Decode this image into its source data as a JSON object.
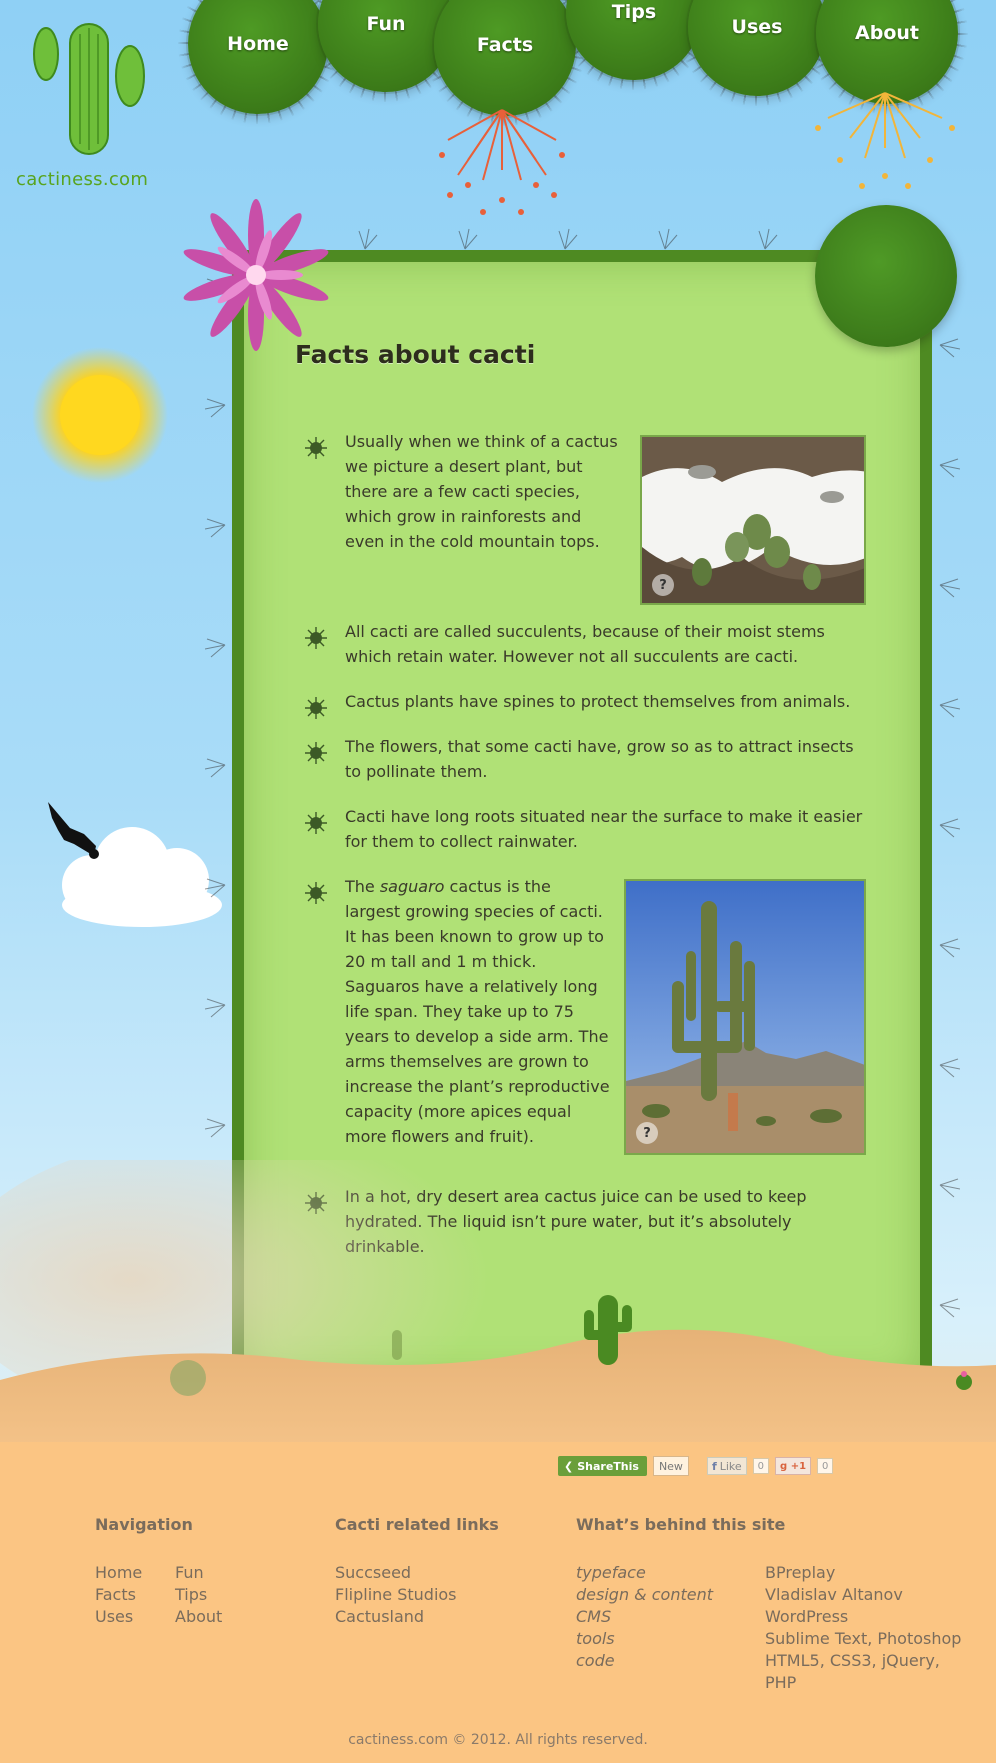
{
  "site": {
    "logo_text": "cactiness.com"
  },
  "nav": {
    "items": [
      {
        "label": "Home"
      },
      {
        "label": "Fun"
      },
      {
        "label": "Facts"
      },
      {
        "label": "Tips"
      },
      {
        "label": "Uses"
      },
      {
        "label": "About"
      }
    ]
  },
  "main": {
    "title": "Facts about cacti",
    "facts": [
      {
        "text": "Usually when we think of a cactus we picture a desert plant, but there are a few cacti species, which grow in rainforests and even in the cold mountain tops."
      },
      {
        "text": "All cacti are called succulents, because of their moist stems which retain water. However not all succulents are cacti."
      },
      {
        "text": "Cactus plants have spines to protect themselves from animals."
      },
      {
        "text": "The flowers, that some cacti have, grow so as to attract insects to pollinate them."
      },
      {
        "text": "Cacti have long roots situated near the surface to make it easier for them to collect rainwater."
      },
      {
        "lead": "The ",
        "emphasis": "saguaro",
        "text": " cactus is the largest growing species of cacti. It has been known to grow up to 20 m tall and 1 m thick. Saguaros have a relatively long life span. They take up to 75 years to develop a side arm. The arms themselves are grown to increase the plant’s reproductive capacity (more apices equal more flowers and fruit)."
      },
      {
        "text": "In a hot, dry desert area cactus juice can be used to keep hydrated. The liquid isn’t pure water, but it’s absolutely drinkable."
      }
    ],
    "photo_hint": "?"
  },
  "share": {
    "sharethis_label": "ShareThis",
    "new_label": "New",
    "like_label": "Like",
    "like_count": "0",
    "gplus_label": "+1",
    "gplus_count": "0"
  },
  "footer": {
    "navigation": {
      "heading": "Navigation",
      "col1": [
        "Home",
        "Facts",
        "Uses"
      ],
      "col2": [
        "Fun",
        "Tips",
        "About"
      ]
    },
    "links": {
      "heading": "Cacti related links",
      "items": [
        "Succseed",
        "Flipline Studios",
        "Cactusland"
      ]
    },
    "behind": {
      "heading": "What’s behind this site",
      "labels": [
        "typeface",
        "design & content",
        "CMS",
        "tools",
        "code"
      ],
      "values": [
        "BPreplay",
        "Vladislav Altanov",
        "WordPress",
        "Sublime Text, Photoshop",
        "HTML5, CSS3, jQuery,",
        "PHP"
      ]
    },
    "copyright": "cactiness.com © 2012. All rights reserved."
  },
  "colors": {
    "panel_bg": "#b0e176",
    "panel_border": "#4e8a22",
    "nav_bubble": "#3e7f1a",
    "footer_bg": "#fbc583",
    "logo_text": "#58a41f"
  }
}
